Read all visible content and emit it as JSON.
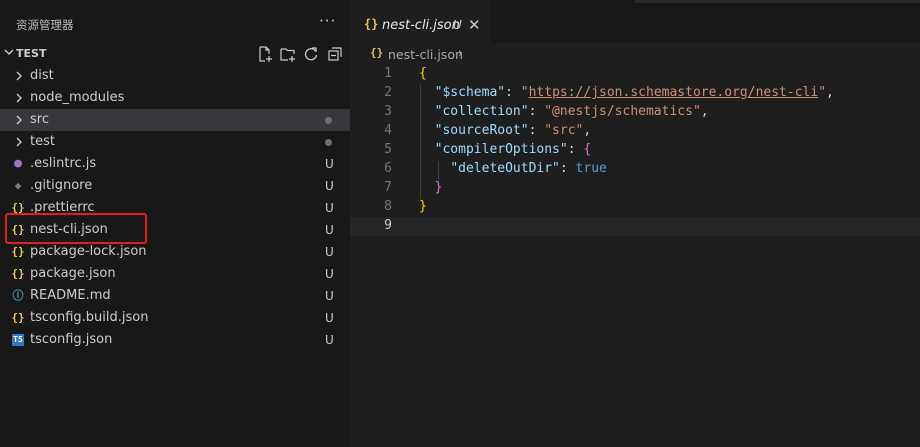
{
  "sidebar": {
    "title": "资源管理器",
    "more": "···",
    "section": "TEST",
    "section_actions": [
      "new-file-icon",
      "new-folder-icon",
      "refresh-icon",
      "collapse-all-icon"
    ]
  },
  "tree": [
    {
      "name": "dist",
      "kind": "folder",
      "status": ""
    },
    {
      "name": "node_modules",
      "kind": "folder",
      "status": ""
    },
    {
      "name": "src",
      "kind": "folder",
      "status": "dot",
      "selected": true
    },
    {
      "name": "test",
      "kind": "folder",
      "status": "dot"
    },
    {
      "name": ".eslintrc.js",
      "kind": "eslint",
      "status": "U"
    },
    {
      "name": ".gitignore",
      "kind": "git",
      "status": "U"
    },
    {
      "name": ".prettierrc",
      "kind": "json",
      "status": "U"
    },
    {
      "name": "nest-cli.json",
      "kind": "json",
      "status": "U",
      "highlighted": true
    },
    {
      "name": "package-lock.json",
      "kind": "json",
      "status": "U"
    },
    {
      "name": "package.json",
      "kind": "json",
      "status": "U"
    },
    {
      "name": "README.md",
      "kind": "info",
      "status": "U"
    },
    {
      "name": "tsconfig.build.json",
      "kind": "json",
      "status": "U"
    },
    {
      "name": "tsconfig.json",
      "kind": "ts",
      "status": "U"
    }
  ],
  "tab": {
    "icon": "{}",
    "name": "nest-cli.json",
    "status": "U",
    "close": "✕"
  },
  "breadcrumb": {
    "icon": "{}",
    "name": "nest-cli.json",
    "sep": "›"
  },
  "editor": {
    "current_line": 9,
    "lines": [
      [
        {
          "t": "{",
          "c": "b1"
        }
      ],
      [
        {
          "t": "  "
        },
        {
          "t": "\"$schema\"",
          "c": "k"
        },
        {
          "t": ": "
        },
        {
          "t": "\"",
          "c": "s"
        },
        {
          "t": "https://json.schemastore.org/nest-cli",
          "c": "url"
        },
        {
          "t": "\"",
          "c": "s"
        },
        {
          "t": ","
        }
      ],
      [
        {
          "t": "  "
        },
        {
          "t": "\"collection\"",
          "c": "k"
        },
        {
          "t": ": "
        },
        {
          "t": "\"@nestjs/schematics\"",
          "c": "s"
        },
        {
          "t": ","
        }
      ],
      [
        {
          "t": "  "
        },
        {
          "t": "\"sourceRoot\"",
          "c": "k"
        },
        {
          "t": ": "
        },
        {
          "t": "\"src\"",
          "c": "s"
        },
        {
          "t": ","
        }
      ],
      [
        {
          "t": "  "
        },
        {
          "t": "\"compilerOptions\"",
          "c": "k"
        },
        {
          "t": ": "
        },
        {
          "t": "{",
          "c": "b2"
        }
      ],
      [
        {
          "t": "    "
        },
        {
          "t": "\"deleteOutDir\"",
          "c": "k"
        },
        {
          "t": ": "
        },
        {
          "t": "true",
          "c": "kw"
        }
      ],
      [
        {
          "t": "  "
        },
        {
          "t": "}",
          "c": "b2"
        }
      ],
      [
        {
          "t": "}",
          "c": "b1"
        }
      ],
      []
    ]
  },
  "colors": {
    "json_icon": "#e2c26b",
    "eslint_icon": "#a074c4",
    "git_icon": "#6d8086",
    "info_icon": "#519aba",
    "ts_icon": "#3178c6",
    "highlight_box": "#e0201b"
  }
}
